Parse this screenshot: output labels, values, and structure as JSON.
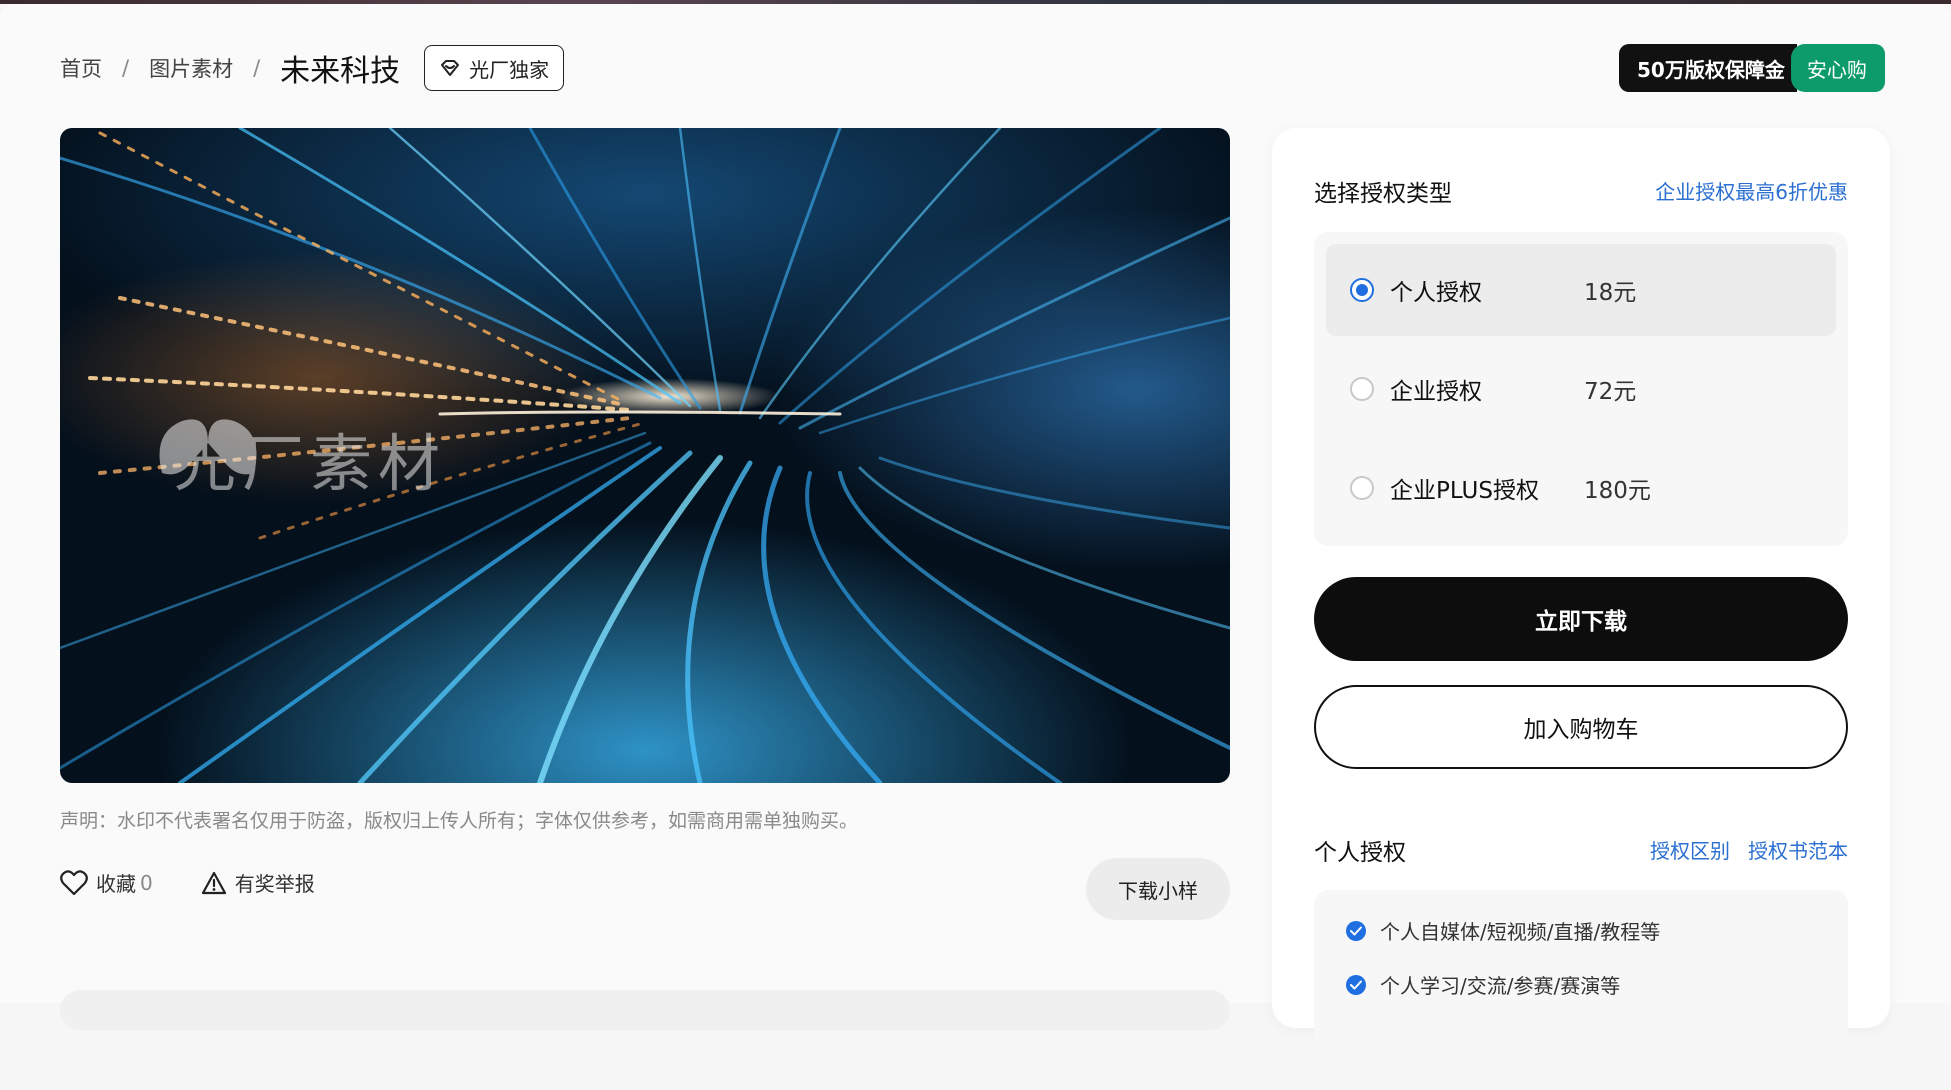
{
  "breadcrumb": {
    "home": "首页",
    "category": "图片素材",
    "separator": "/",
    "current": "未来科技",
    "badge": "光厂独家"
  },
  "guarantee": {
    "left_label": "50万版权保障金",
    "right_label": "安心购",
    "accent_color": "#0e9b6c"
  },
  "image": {
    "watermark": "光厂素材",
    "description": "futuristic light-speed tunnel"
  },
  "disclaimer": "声明：水印不代表署名仅用于防盗，版权归上传人所有；字体仅供参考，如需商用需单独购买。",
  "actions": {
    "favorite_label": "收藏",
    "favorite_count": "0",
    "report_label": "有奖举报",
    "sample_label": "下载小样"
  },
  "license": {
    "title": "选择授权类型",
    "promo": "企业授权最高6折优惠",
    "options": [
      {
        "name": "个人授权",
        "price": "18元",
        "selected": true
      },
      {
        "name": "企业授权",
        "price": "72元",
        "selected": false
      },
      {
        "name": "企业PLUS授权",
        "price": "180元",
        "selected": false
      }
    ],
    "download_button": "立即下载",
    "cart_button": "加入购物车"
  },
  "personal": {
    "title": "个人授权",
    "link_diff": "授权区别",
    "link_sample": "授权书范本",
    "items": [
      "个人自媒体/短视频/直播/教程等",
      "个人学习/交流/参赛/赛演等"
    ]
  },
  "colors": {
    "link": "#2a6fd1",
    "primary_button": "#0d0d0d",
    "radio_selected": "#1f6fe0"
  }
}
